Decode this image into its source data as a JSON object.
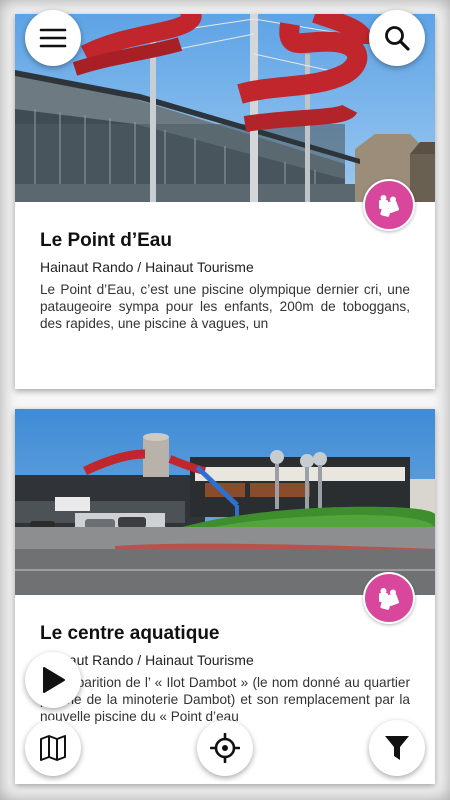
{
  "cards": [
    {
      "title": "Le Point d’Eau",
      "source": "Hainaut Rando / Hainaut Tourisme",
      "description": "Le Point d’Eau, c’est une piscine olympique dernier cri, une pataugeoire sympa pour les enfants, 200m de toboggans, des rapides, une piscine à vagues, un",
      "category_icon": "puzzle-icon",
      "photo": "indoor pool building with red water slides"
    },
    {
      "title": "Le centre aquatique",
      "source": "Hainaut Rando / Hainaut Tourisme",
      "description": "La disparition de l’ « Ilot Dambot » (le nom donné au quartier proche de la minoterie Dambot) et son remplacement par la nouvelle piscine du « Point d’eau",
      "category_icon": "puzzle-icon",
      "photo": "aquatic center with roundabout in front"
    }
  ],
  "controls": {
    "menu_icon": "menu-icon",
    "search_icon": "search-icon",
    "play_icon": "play-icon",
    "map_icon": "map-icon",
    "locate_icon": "crosshair-icon",
    "filter_icon": "filter-icon"
  },
  "colors": {
    "badge": "#d8479b",
    "slide_red": "#c0262c",
    "sky": "#3f8bd6"
  }
}
